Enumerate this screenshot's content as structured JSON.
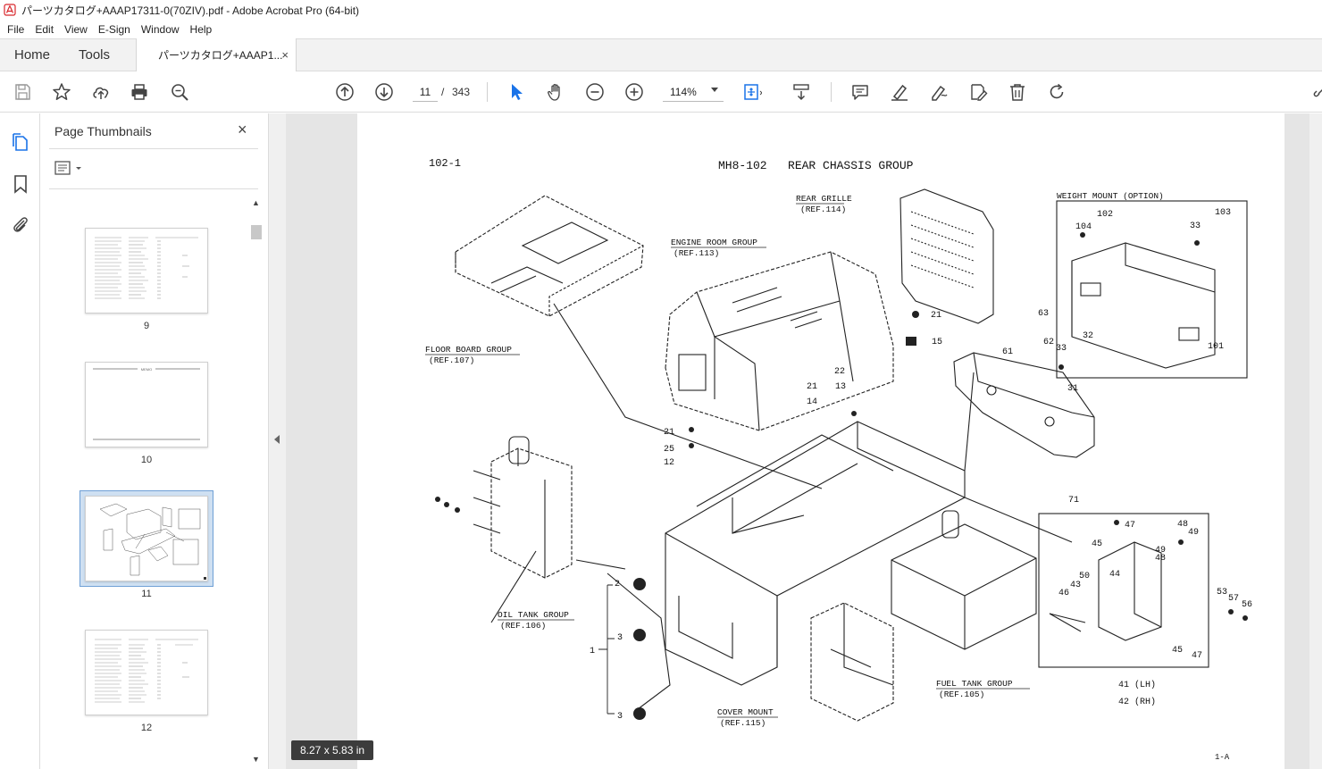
{
  "window": {
    "title": "パーツカタログ+AAAP17311-0(70ZIV).pdf - Adobe Acrobat Pro (64-bit)"
  },
  "menu": [
    "File",
    "Edit",
    "View",
    "E-Sign",
    "Window",
    "Help"
  ],
  "tabs": {
    "home": "Home",
    "tools": "Tools",
    "document": "パーツカタログ+AAAP1...",
    "document_close": "×"
  },
  "toolbar": {
    "current_page": "11",
    "page_separator": "/",
    "total_pages": "343",
    "zoom": "114%"
  },
  "thumbnails_panel": {
    "title": "Page Thumbnails",
    "close": "×",
    "pages": [
      {
        "label": "9",
        "kind": "table"
      },
      {
        "label": "10",
        "kind": "memo",
        "caption": "MEMO"
      },
      {
        "label": "11",
        "kind": "drawing",
        "selected": true
      },
      {
        "label": "12",
        "kind": "table"
      }
    ]
  },
  "page_size": "8.27 x 5.83 in",
  "document": {
    "page_code": "102-1",
    "title": "MH8-102   REAR CHASSIS GROUP",
    "footer": "1-A",
    "group_labels": [
      {
        "name": "REAR GRILLE",
        "ref": "(REF.114)"
      },
      {
        "name": "ENGINE ROOM GROUP",
        "ref": "(REF.113)"
      },
      {
        "name": "FLOOR BOARD GROUP",
        "ref": "(REF.107)"
      },
      {
        "name": "OIL TANK GROUP",
        "ref": "(REF.106)"
      },
      {
        "name": "COVER MOUNT",
        "ref": "(REF.115)"
      },
      {
        "name": "FUEL TANK GROUP",
        "ref": "(REF.105)"
      },
      {
        "name": "WEIGHT MOUNT (OPTION)",
        "ref": ""
      }
    ],
    "callouts": [
      "104",
      "102",
      "33",
      "103",
      "101",
      "63",
      "21",
      "15",
      "62",
      "61",
      "33",
      "32",
      "31",
      "22",
      "21",
      "13",
      "14",
      "21",
      "25",
      "12",
      "71",
      "47",
      "48",
      "49",
      "45",
      "49",
      "48",
      "44",
      "50",
      "43",
      "46",
      "53",
      "57",
      "56",
      "45",
      "47",
      "2",
      "3",
      "1",
      "3"
    ],
    "side_labels": [
      "41 (LH)",
      "42 (RH)"
    ]
  }
}
